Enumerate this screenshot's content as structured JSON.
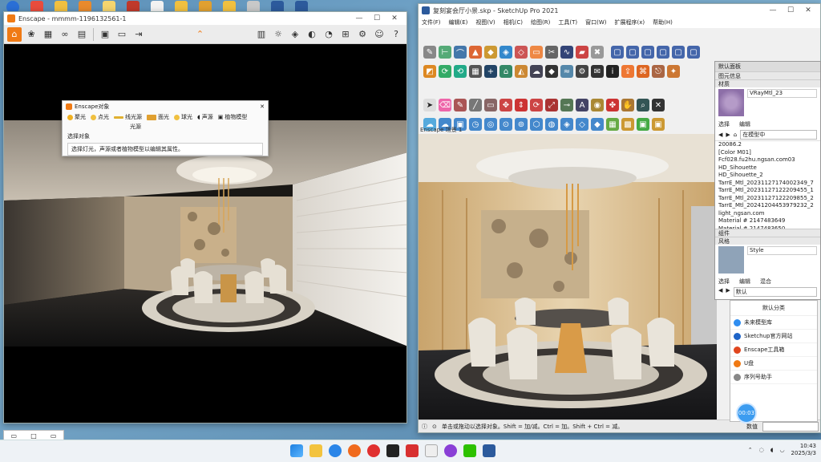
{
  "enscape": {
    "title": "Enscape - mmmm-1196132561-1",
    "dialog": {
      "title": "Enscape对象",
      "tools": [
        "聚光",
        "点光",
        "线光源",
        "面光",
        "球光",
        "声源",
        "植物模型"
      ],
      "sub_label": "光源",
      "section_label": "选择对象",
      "hint": "选择灯光，声源或者植物模型以编辑其属性。"
    },
    "taskbar_label": "Enscape"
  },
  "sketchup": {
    "title": "复刻宴会厅小景.skp - SketchUp Pro 2021",
    "menu": [
      "文件(F)",
      "编辑(E)",
      "视图(V)",
      "相机(C)",
      "绘图(R)",
      "工具(T)",
      "窗口(W)",
      "扩展程序(x)",
      "帮助(H)"
    ],
    "scene_tab": "Enscape  场景 1",
    "status_text": "单击或拖动以选择对象。Shift = 加/减。Ctrl = 加。Shift + Ctrl = 减。",
    "measure_label": "数值"
  },
  "tray": {
    "title": "默认面板",
    "sections": [
      "图元信息",
      "材质"
    ],
    "material_name": "VRayMtl_23",
    "tabs": [
      "选择",
      "编辑"
    ],
    "model_dropdown": "在模型中",
    "materials": [
      "20086.2",
      "[Color M01]",
      "Fcf028.fu2hu.ngsan.com03",
      "HD_Sihouette",
      "HD_Sihouette_2",
      "TarrE_Mtl_20231127174002349_7",
      "TarrE_Mtl_20231127122209455_1",
      "TarrE_Mtl_20231127122209855_2",
      "TarrE_Mtl_20241204453979232_2",
      "light_ngsan.com",
      "Material # 2147483649",
      "Material # 2147483650"
    ],
    "components_section": "组件",
    "styles_section": "风格",
    "style_name": "Style",
    "style_tabs": [
      "选择",
      "编辑",
      "混合"
    ],
    "style_dropdown": "默认"
  },
  "assistant": {
    "title": "默认分类",
    "items": [
      {
        "label": "未来模型库",
        "color": "#2f8df0"
      },
      {
        "label": "Sketchup官方网站",
        "color": "#1e64c8"
      },
      {
        "label": "Enscape工具箱",
        "color": "#e0461e"
      },
      {
        "label": "U盘",
        "color": "#f07a14"
      },
      {
        "label": "序列号助手",
        "color": "#888888"
      }
    ],
    "fab_label": "00:03"
  },
  "mini_window": {
    "icons": [
      "▭",
      "□",
      "▭"
    ]
  },
  "taskbar": {
    "time": "10:43",
    "date": "2025/3/3"
  }
}
